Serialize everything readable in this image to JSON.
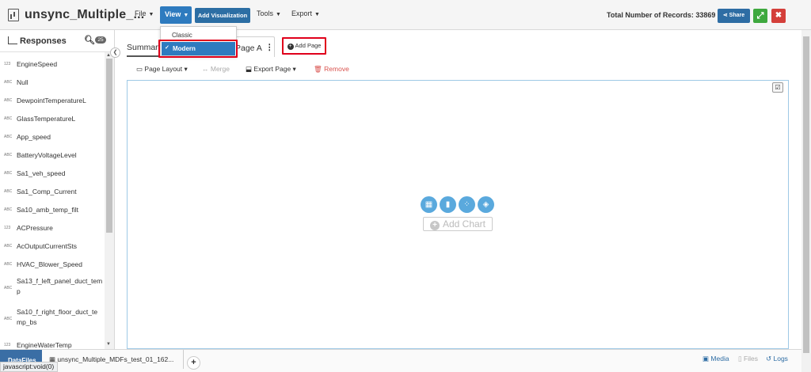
{
  "header": {
    "app_title": "unsync_Multiple_...",
    "menus": [
      "File",
      "View",
      "Tools",
      "Export"
    ],
    "add_visualization": "Add Visualization",
    "records_label": "Total Number of Records: 33869",
    "share_label": "Share",
    "brand_blue": "#2e7bbf",
    "green": "#3ea83e",
    "red": "#d43f3a"
  },
  "view_menu": {
    "options": [
      {
        "label": "Classic",
        "selected": false
      },
      {
        "label": "Modern",
        "selected": true
      }
    ]
  },
  "sidebar": {
    "title": "Responses",
    "count": "25",
    "items": [
      {
        "type": "123",
        "name": "EngineSpeed"
      },
      {
        "type": "ABC",
        "name": "Null"
      },
      {
        "type": "ABC",
        "name": "DewpointTemperatureL"
      },
      {
        "type": "ABC",
        "name": "GlassTemperatureL"
      },
      {
        "type": "ABC",
        "name": "App_speed"
      },
      {
        "type": "ABC",
        "name": "BatteryVoltageLevel"
      },
      {
        "type": "ABC",
        "name": "Sa1_veh_speed"
      },
      {
        "type": "ABC",
        "name": "Sa1_Comp_Current"
      },
      {
        "type": "ABC",
        "name": "Sa10_amb_temp_filt"
      },
      {
        "type": "123",
        "name": "ACPressure"
      },
      {
        "type": "ABC",
        "name": "AcOutputCurrentSts"
      },
      {
        "type": "ABC",
        "name": "HVAC_Blower_Speed"
      },
      {
        "type": "ABC",
        "name": "Sa13_f_left_panel_duct_tem",
        "line2": "p"
      },
      {
        "type": "ABC",
        "name": "Sa10_f_right_floor_duct_te",
        "line2": "mp_bs"
      },
      {
        "type": "123",
        "name": "EngineWaterTemp"
      }
    ]
  },
  "tabs": {
    "summary": "Summary",
    "page_a": "Page A",
    "add_page": "Add Page"
  },
  "page_toolbar": {
    "page_layout": "Page Layout",
    "merge": "Merge",
    "export_page": "Export Page",
    "remove": "Remove"
  },
  "canvas": {
    "add_chart": "Add Chart",
    "chart_icons": [
      "table-icon",
      "bar-chart-icon",
      "scatter-icon",
      "map-icon"
    ]
  },
  "footer": {
    "datafile_tab": "DataFiles",
    "file_tab": "unsync_Multiple_MDFs_test_01_162...",
    "status_url": "javascript:void(0)",
    "media": "Media",
    "files": "Files",
    "logs": "Logs"
  }
}
